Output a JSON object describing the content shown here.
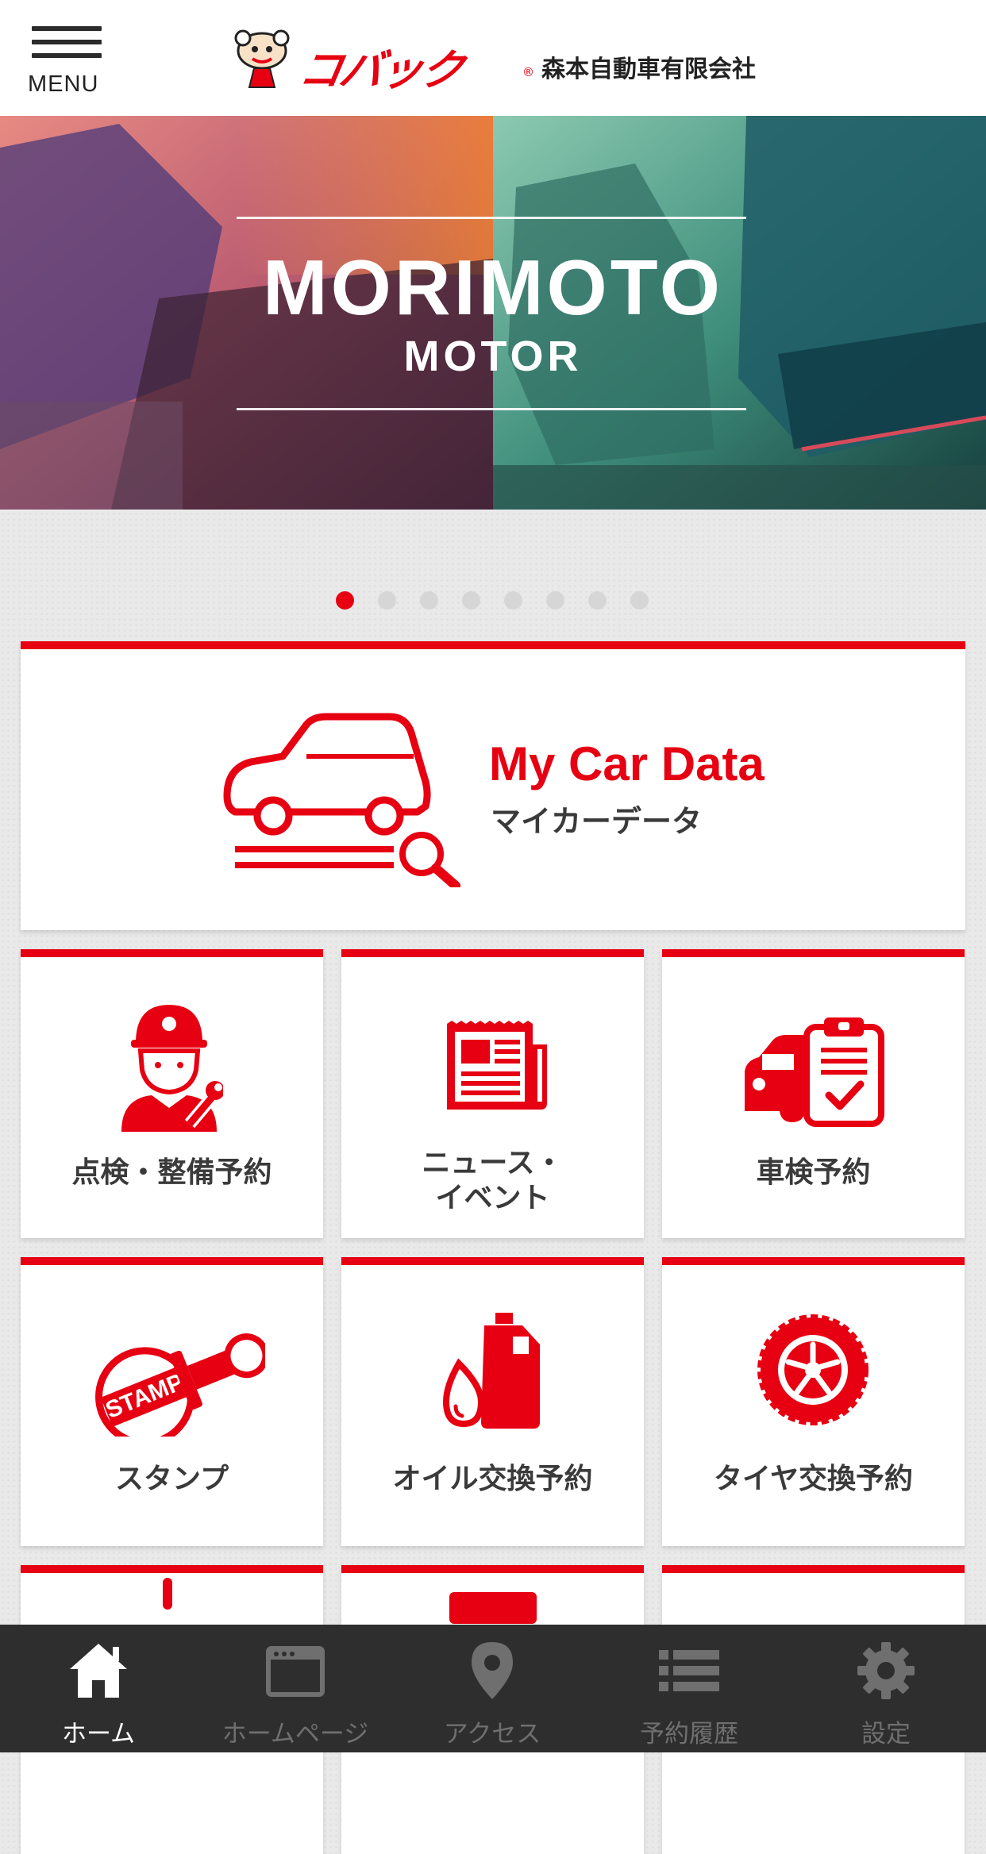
{
  "header": {
    "menu_label": "MENU",
    "brand_name": "コバック",
    "company_name": "森本自動車有限会社"
  },
  "hero": {
    "title": "MORIMOTO",
    "subtitle": "MOTOR",
    "slide_count": 8,
    "active_slide": 1
  },
  "featured": {
    "title": "My Car Data",
    "subtitle": "マイカーデータ"
  },
  "tiles": [
    {
      "label": "点検・整備予約",
      "icon": "mechanic-icon"
    },
    {
      "label": "ニュース・\nイベント",
      "icon": "newspaper-icon"
    },
    {
      "label": "車検予約",
      "icon": "inspection-clipboard-icon"
    },
    {
      "label": "スタンプ",
      "icon": "stamp-icon"
    },
    {
      "label": "オイル交換予約",
      "icon": "oil-can-icon"
    },
    {
      "label": "タイヤ交換予約",
      "icon": "tire-icon"
    }
  ],
  "stamp_icon_text": "STAMP",
  "tabbar": {
    "items": [
      {
        "label": "ホーム",
        "icon": "home-icon",
        "active": true
      },
      {
        "label": "ホームページ",
        "icon": "browser-icon",
        "active": false
      },
      {
        "label": "アクセス",
        "icon": "map-pin-icon",
        "active": false
      },
      {
        "label": "予約履歴",
        "icon": "list-icon",
        "active": false
      },
      {
        "label": "設定",
        "icon": "gear-icon",
        "active": false
      }
    ]
  },
  "colors": {
    "accent": "#e60012",
    "tabbar_bg": "#2e2e2e",
    "tab_active": "#ffffff",
    "tab_inactive": "#6f6f6f"
  }
}
